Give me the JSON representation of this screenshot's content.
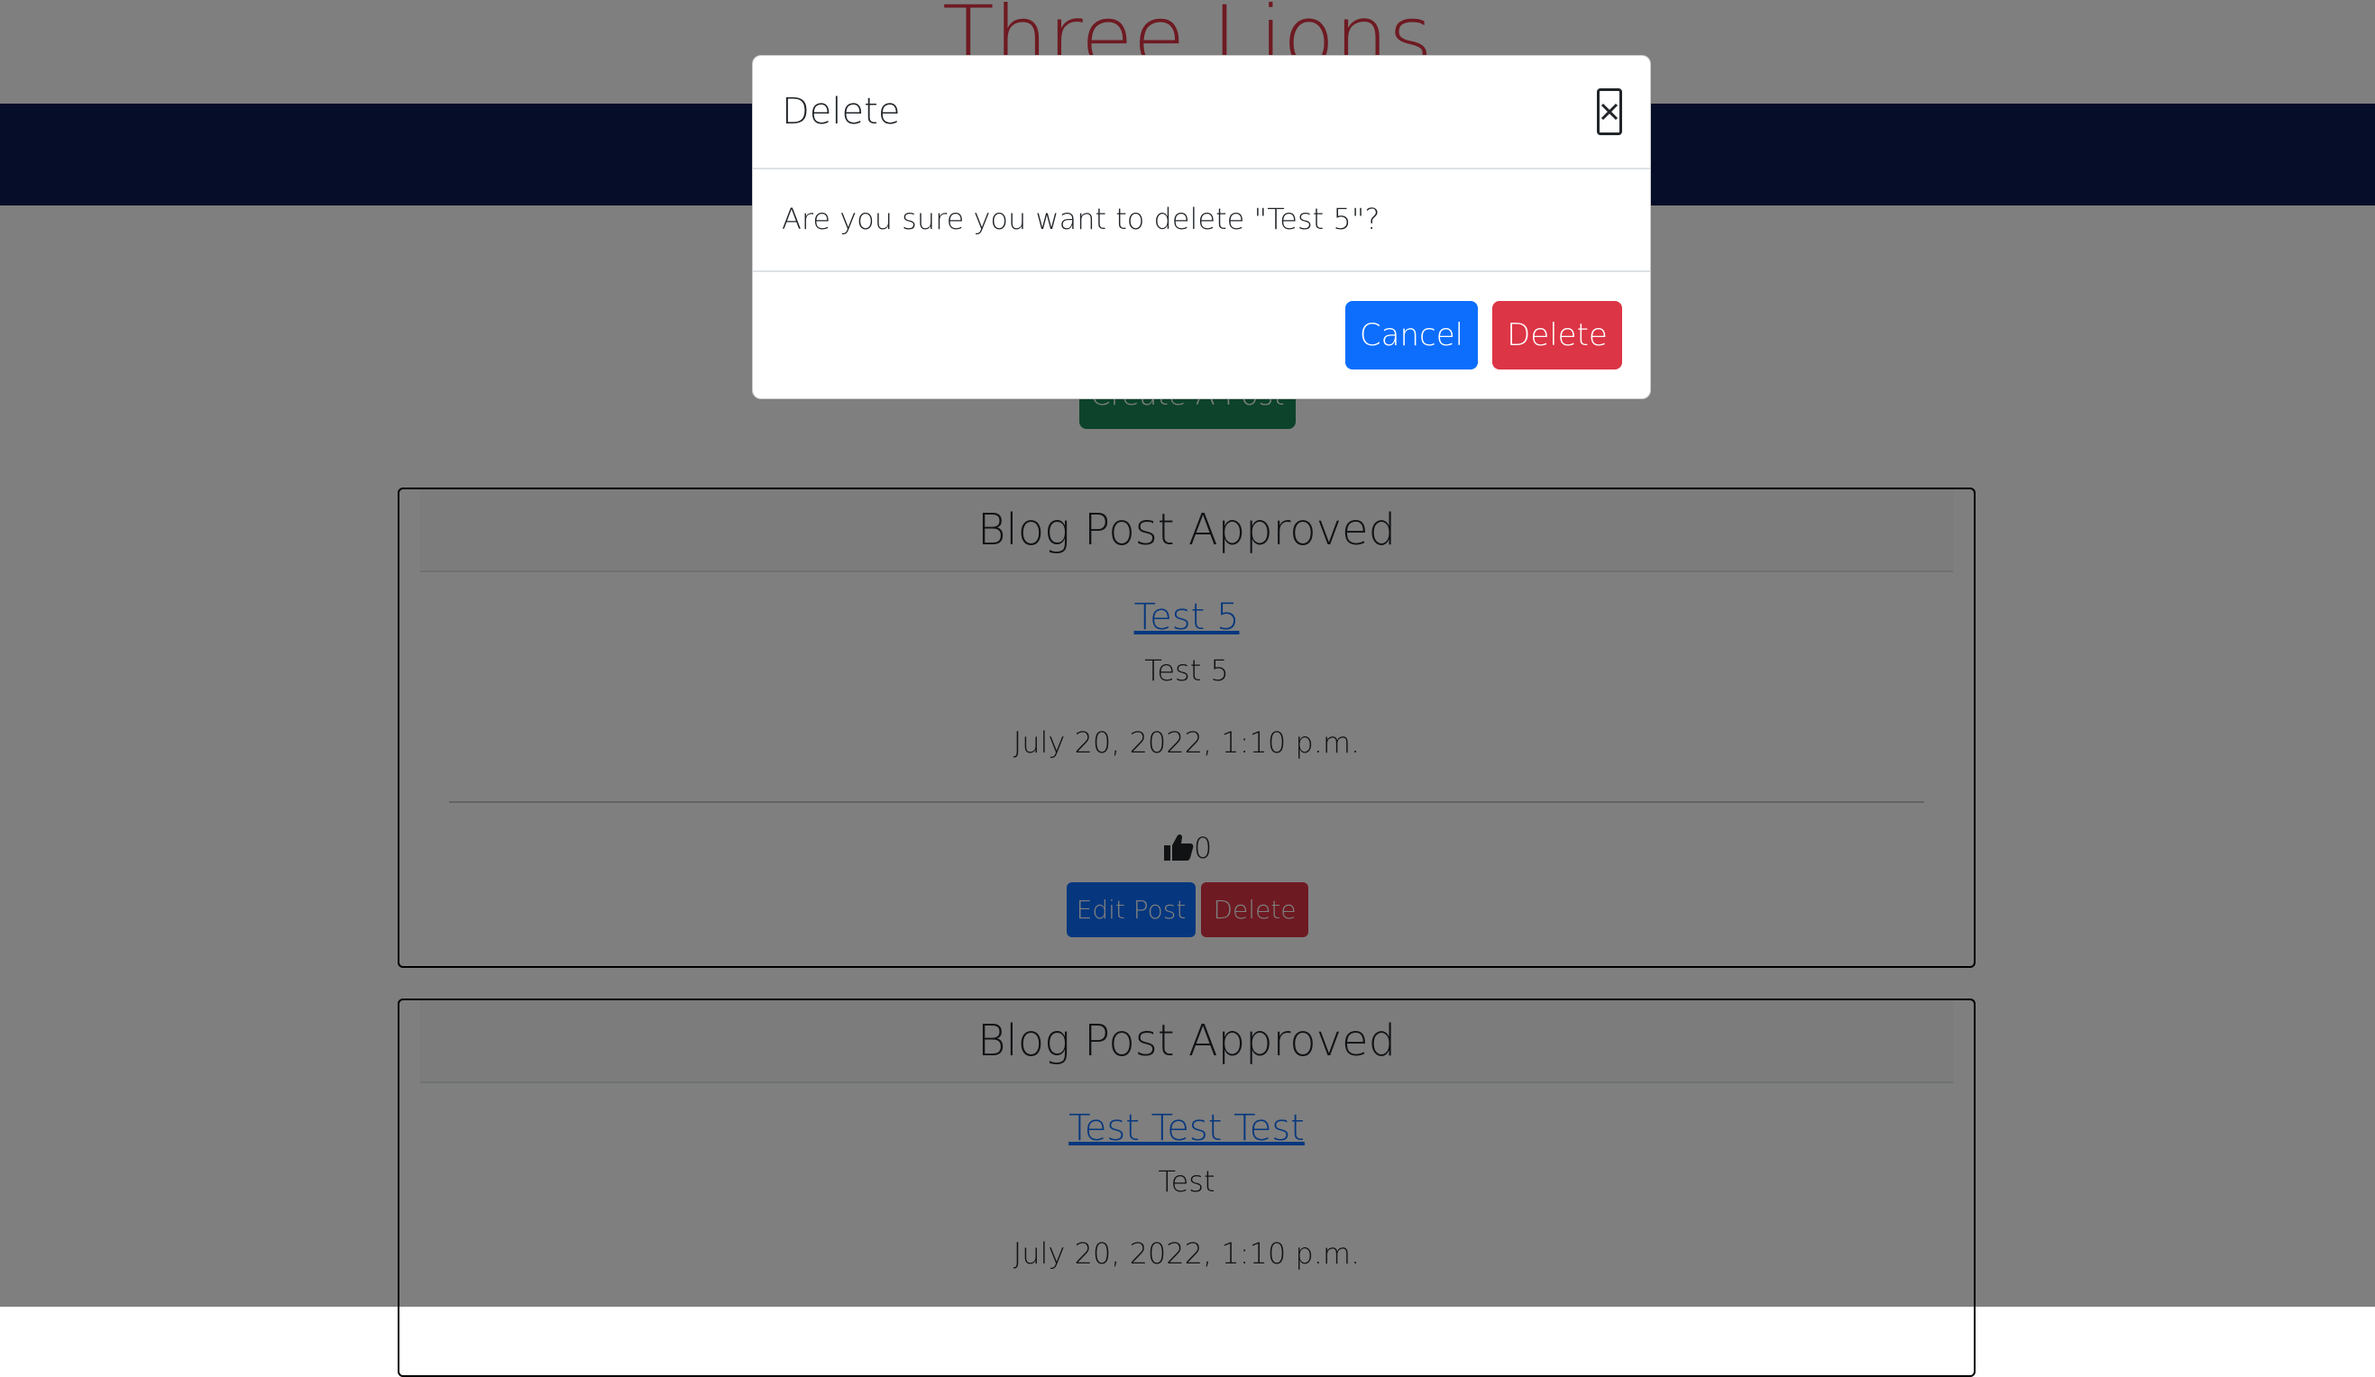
{
  "site": {
    "title": "Three Lions"
  },
  "actions": {
    "create_post_label": "Create A Post"
  },
  "posts": [
    {
      "status": "Blog Post Approved",
      "title": "Test 5",
      "excerpt": "Test 5",
      "date": "July 20, 2022, 1:10 p.m.",
      "likes": "0",
      "edit_label": "Edit Post",
      "delete_label": "Delete"
    },
    {
      "status": "Blog Post Approved",
      "title": "Test Test Test",
      "excerpt": "Test",
      "date": "July 20, 2022, 1:10 p.m."
    }
  ],
  "modal": {
    "title": "Delete",
    "close_icon": "close-icon",
    "message": "Are you sure you want to delete \"Test 5\"?",
    "cancel_label": "Cancel",
    "delete_label": "Delete"
  },
  "colors": {
    "brand_red": "#dc3545",
    "navbar": "#0a1a52",
    "primary": "#0d6efd",
    "success": "#198754",
    "backdrop": "rgba(0,0,0,0.5)"
  }
}
